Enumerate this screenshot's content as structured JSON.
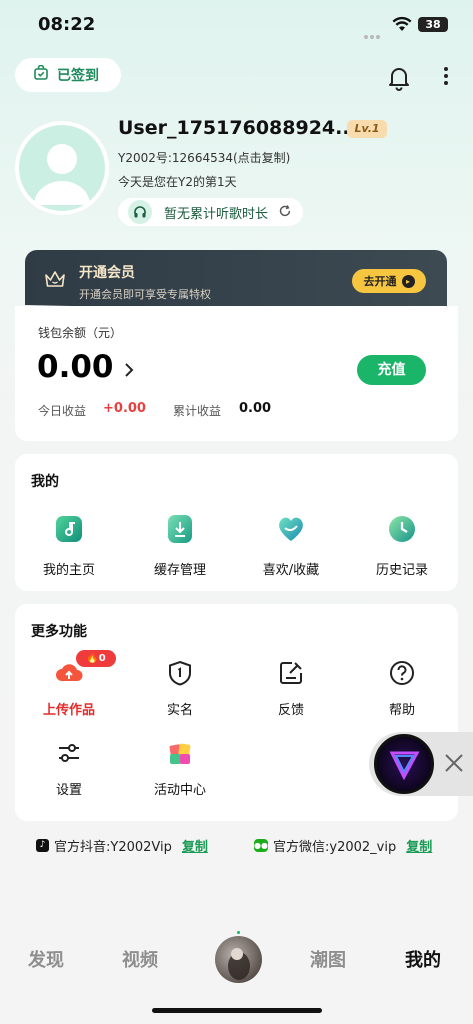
{
  "status_bar": {
    "time": "08:22",
    "battery": "38"
  },
  "header": {
    "checkin_label": "已签到"
  },
  "profile": {
    "username": "User_175176088924...",
    "level": "Lv.1",
    "uid_text": "Y2002号:12664534(点击复制)",
    "days_text": "今天是您在Y2的第1天",
    "listen_text": "暂无累计听歌时长"
  },
  "vip": {
    "title": "开通会员",
    "subtitle": "开通会员即可享受专属特权",
    "button": "去开通"
  },
  "wallet": {
    "label": "钱包余额（元）",
    "amount": "0.00",
    "recharge": "充值",
    "today_label": "今日收益",
    "today_value": "+0.00",
    "total_label": "累计收益",
    "total_value": "0.00"
  },
  "mine": {
    "title": "我的",
    "items": [
      {
        "label": "我的主页",
        "icon": "home-page-icon"
      },
      {
        "label": "缓存管理",
        "icon": "download-cache-icon"
      },
      {
        "label": "喜欢/收藏",
        "icon": "heart-favorite-icon"
      },
      {
        "label": "历史记录",
        "icon": "history-clock-icon"
      }
    ]
  },
  "more": {
    "title": "更多功能",
    "upload_badge": "0",
    "items": [
      {
        "label": "上传作品",
        "icon": "cloud-upload-icon"
      },
      {
        "label": "实名",
        "icon": "shield-id-icon"
      },
      {
        "label": "反馈",
        "icon": "feedback-edit-icon"
      },
      {
        "label": "帮助",
        "icon": "help-question-icon"
      },
      {
        "label": "设置",
        "icon": "settings-sliders-icon"
      },
      {
        "label": "活动中心",
        "icon": "gift-activity-icon"
      }
    ]
  },
  "official": {
    "douyin": "官方抖音:Y2002Vip",
    "wechat": "官方微信:y2002_vip",
    "copy": "复制"
  },
  "nav": {
    "items": [
      "发现",
      "视频",
      "潮图",
      "我的"
    ],
    "active": "我的"
  },
  "colors": {
    "accent_green": "#1bb56a",
    "red": "#e84141",
    "vip_gold": "#f6c640"
  }
}
